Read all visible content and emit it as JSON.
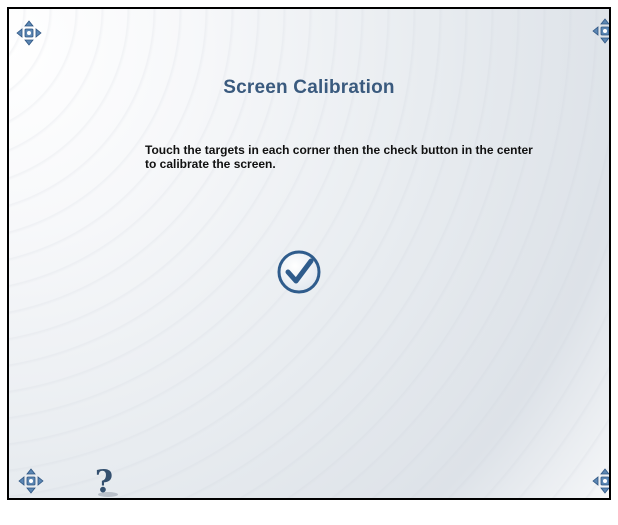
{
  "screen": {
    "title": "Screen Calibration",
    "instructions": "Touch the targets in each corner then the check button in the center to calibrate the screen."
  },
  "controls": {
    "help_label": "?",
    "check_icon": "checkmark-circle-icon",
    "target_icon": "crosshair-arrows-icon"
  },
  "colors": {
    "title": "#3a5a7e",
    "accent": "#2f5c8c",
    "help": "#34506f",
    "border": "#000000"
  }
}
